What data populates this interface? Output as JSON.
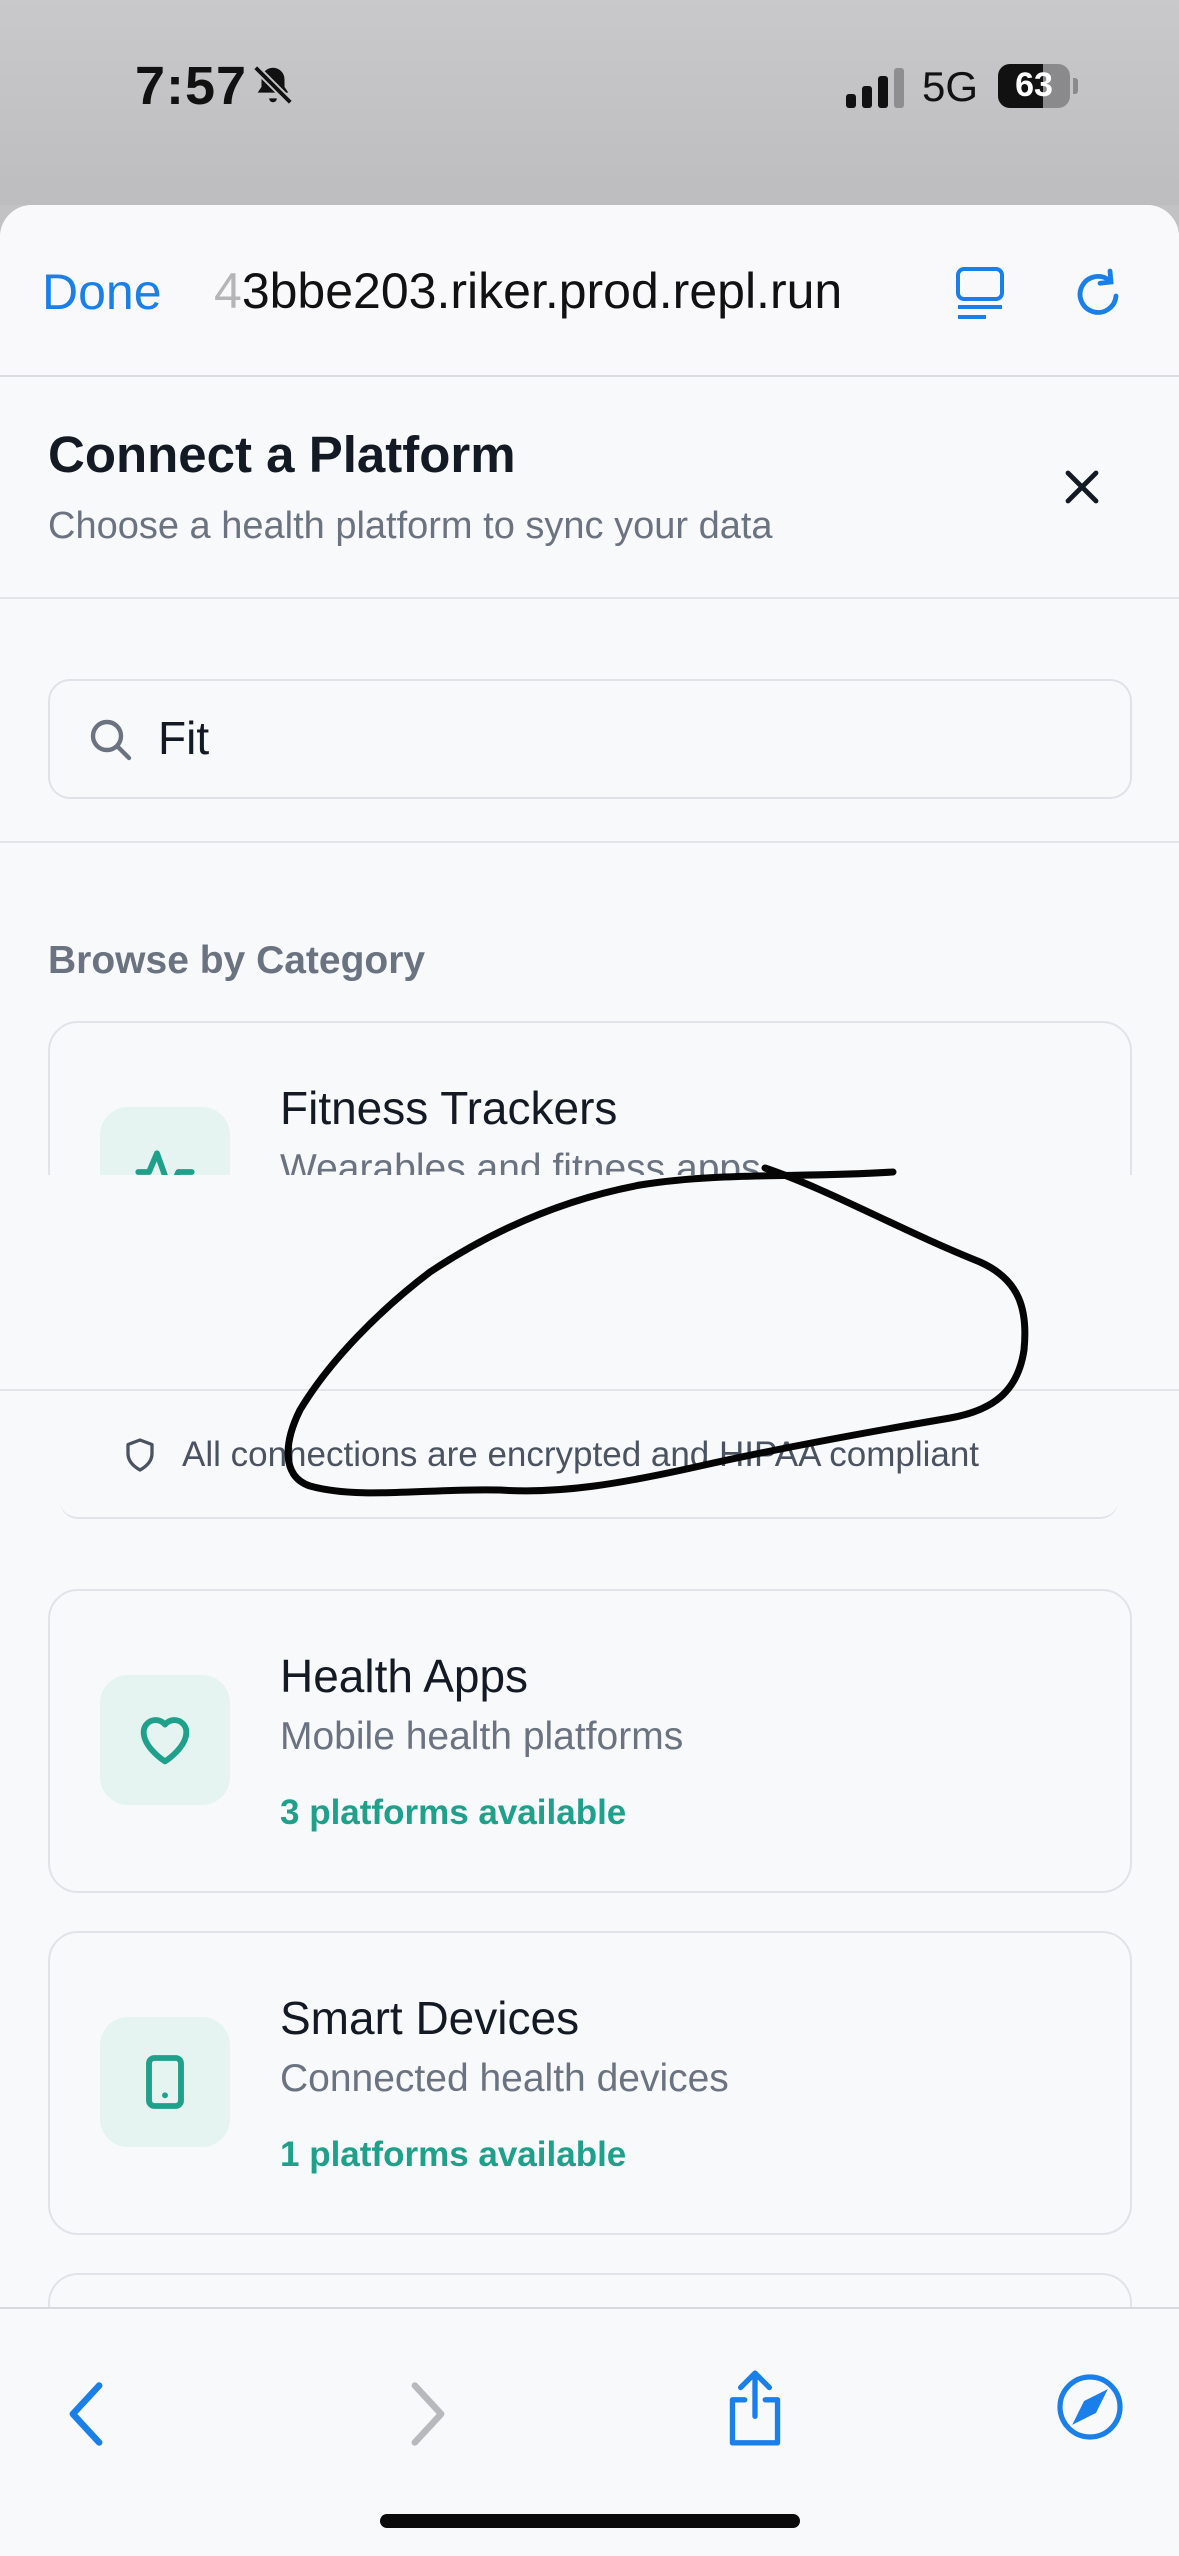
{
  "status_bar": {
    "time": "7:57",
    "network": "5G",
    "battery": "63",
    "icons": [
      "bell-muted-icon",
      "signal-icon",
      "battery-icon"
    ]
  },
  "browser": {
    "done_label": "Done",
    "url_fade": "4",
    "url": "3bbe203.riker.prod.repl.run",
    "accent_color": "#1a7fe8"
  },
  "modal": {
    "title": "Connect a Platform",
    "subtitle": "Choose a health platform to sync your data"
  },
  "search": {
    "value": "Fit"
  },
  "browse": {
    "label": "Browse by Category",
    "categories": [
      {
        "title": "Fitness Trackers",
        "description": "Wearables and fitness apps",
        "icon": "activity-icon"
      },
      {
        "title": "Health Apps",
        "description": "Mobile health platforms",
        "count": "3 platforms available",
        "icon": "heart-icon"
      },
      {
        "title": "Smart Devices",
        "description": "Connected health devices",
        "count": "1 platforms available",
        "icon": "tablet-icon"
      }
    ]
  },
  "banner": {
    "text": "All connections are encrypted and HIPAA compliant"
  },
  "colors": {
    "teal": "#1fa08a",
    "icon_bg": "#e5f3f1"
  }
}
